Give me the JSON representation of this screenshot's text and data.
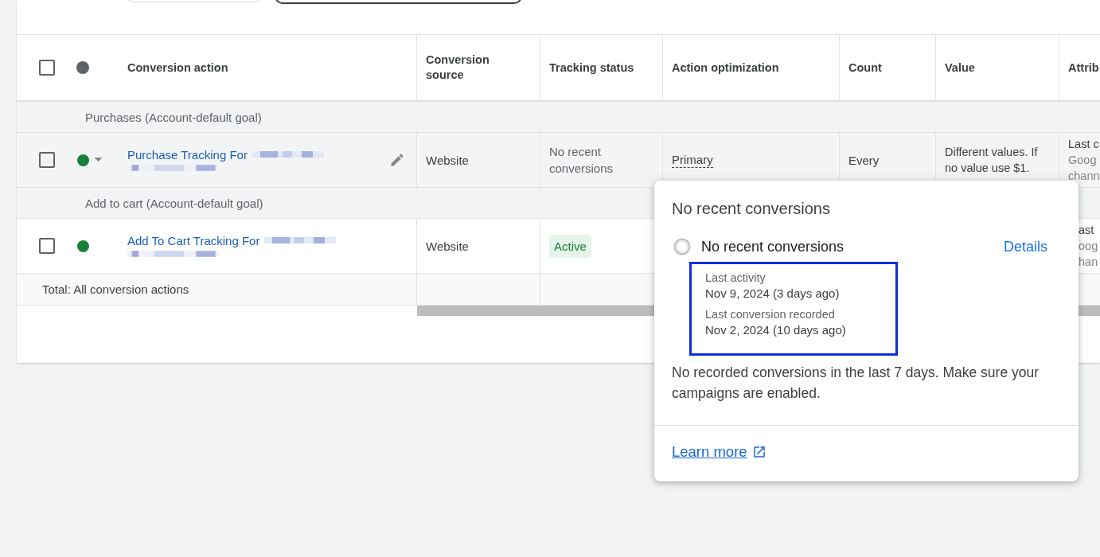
{
  "table": {
    "header_checkbox": {
      "checked": false
    },
    "columns": [
      "Conversion action",
      "Conversion source",
      "Tracking status",
      "Action optimization",
      "Count",
      "Value",
      "Attrib"
    ],
    "groups": [
      {
        "label": "Purchases (Account-default goal)",
        "rows": [
          {
            "checked": false,
            "expandable": true,
            "editable": true,
            "hovered": true,
            "name": "Purchase Tracking For",
            "source": "Website",
            "tracking": {
              "kind": "text",
              "label": "No recent conversions"
            },
            "optimization": "Primary",
            "count": "Every",
            "value": "Different values. If no value use $1.",
            "attribution": {
              "title": "Last c",
              "details": [
                "Goog",
                "chann"
              ]
            }
          }
        ]
      },
      {
        "label": "Add to cart (Account-default goal)",
        "rows": [
          {
            "checked": false,
            "expandable": false,
            "editable": false,
            "hovered": false,
            "name": "Add To Cart Tracking For",
            "source": "Website",
            "tracking": {
              "kind": "chip",
              "label": "Active"
            },
            "attribution": {
              "title": "ast",
              "details": [
                "oog",
                "han"
              ]
            }
          }
        ]
      }
    ],
    "total": "Total: All conversion actions"
  },
  "popup": {
    "title": "No recent conversions",
    "status": "No recent conversions",
    "details_link": "Details",
    "highlighted": true,
    "facts": [
      {
        "label": "Last activity",
        "value": "Nov 9, 2024 (3 days ago)"
      },
      {
        "label": "Last conversion recorded",
        "value": "Nov 2, 2024 (10 days ago)"
      }
    ],
    "message": "No recorded conversions in the last 7 days. Make sure your campaigns are enabled.",
    "learn_more": "Learn more"
  }
}
